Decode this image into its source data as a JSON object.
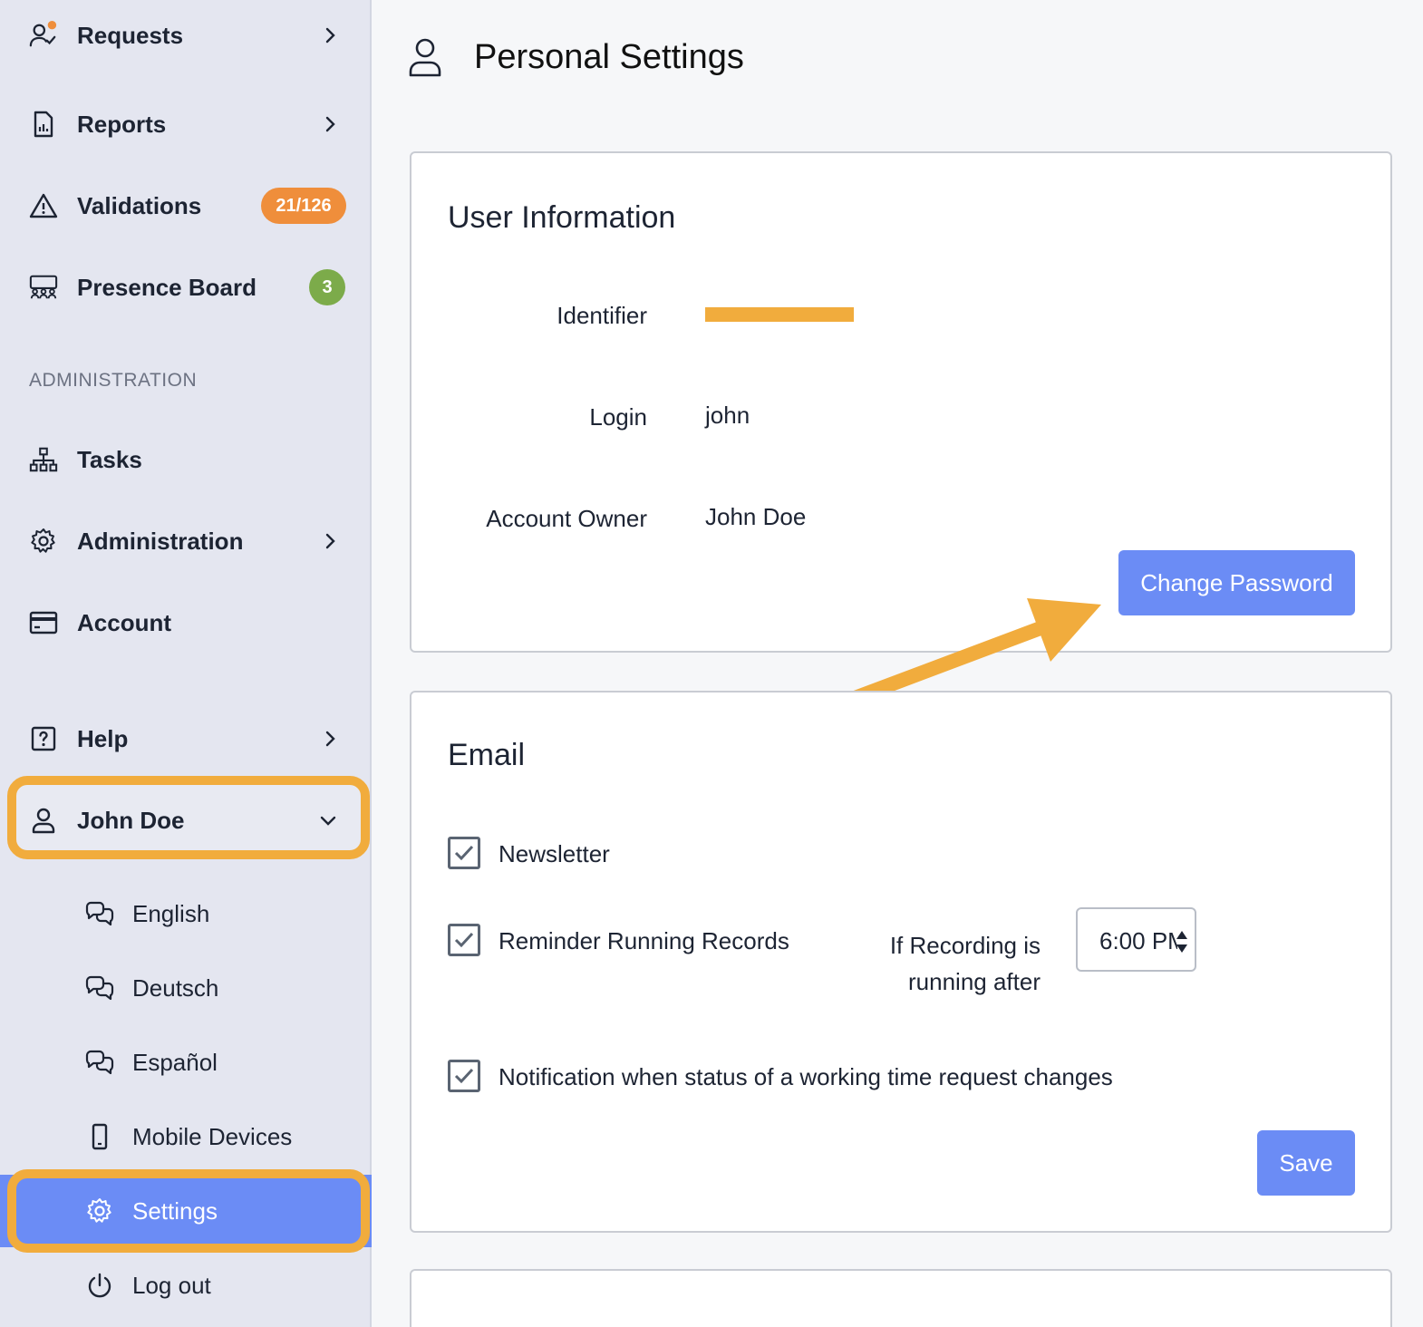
{
  "sidebar": {
    "items": [
      {
        "label": "Requests",
        "icon": "user-check-icon"
      },
      {
        "label": "Reports",
        "icon": "report-document-icon"
      },
      {
        "label": "Validations",
        "icon": "warning-triangle-icon",
        "badge": "21/126"
      },
      {
        "label": "Presence Board",
        "icon": "presence-board-icon",
        "badge": "3"
      }
    ],
    "section_title": "ADMINISTRATION",
    "admin_items": [
      {
        "label": "Tasks",
        "icon": "hierarchy-icon"
      },
      {
        "label": "Administration",
        "icon": "gear-icon"
      },
      {
        "label": "Account",
        "icon": "credit-card-icon"
      }
    ],
    "help_label": "Help",
    "user_label": "John Doe",
    "user_sub_items": [
      {
        "label": "English",
        "icon": "language-chat-icon"
      },
      {
        "label": "Deutsch",
        "icon": "language-chat-icon"
      },
      {
        "label": "Español",
        "icon": "language-chat-icon"
      },
      {
        "label": "Mobile Devices",
        "icon": "mobile-phone-icon"
      },
      {
        "label": "Settings",
        "icon": "gear-icon"
      },
      {
        "label": "Log out",
        "icon": "power-icon"
      }
    ]
  },
  "page": {
    "title": "Personal Settings",
    "icon": "user-icon"
  },
  "user_info": {
    "title": "User Information",
    "identifier_label": "Identifier",
    "login_label": "Login",
    "login_value": "john",
    "owner_label": "Account Owner",
    "owner_value": "John Doe",
    "change_password_label": "Change Password"
  },
  "email": {
    "title": "Email",
    "newsletter_label": "Newsletter",
    "newsletter_checked": true,
    "reminder_label": "Reminder Running Records",
    "reminder_checked": true,
    "recording_label_line1": "If Recording is",
    "recording_label_line2": "running after",
    "recording_time": "6:00 PM",
    "notification_label": "Notification when status of a working time request changes",
    "notification_checked": true,
    "save_label": "Save"
  },
  "colors": {
    "accent": "#6b8cf5",
    "highlight": "#f1ac3d",
    "badge_orange": "#ef8e3b",
    "badge_green": "#7cab4a",
    "sidebar_bg": "#e4e6f0"
  }
}
